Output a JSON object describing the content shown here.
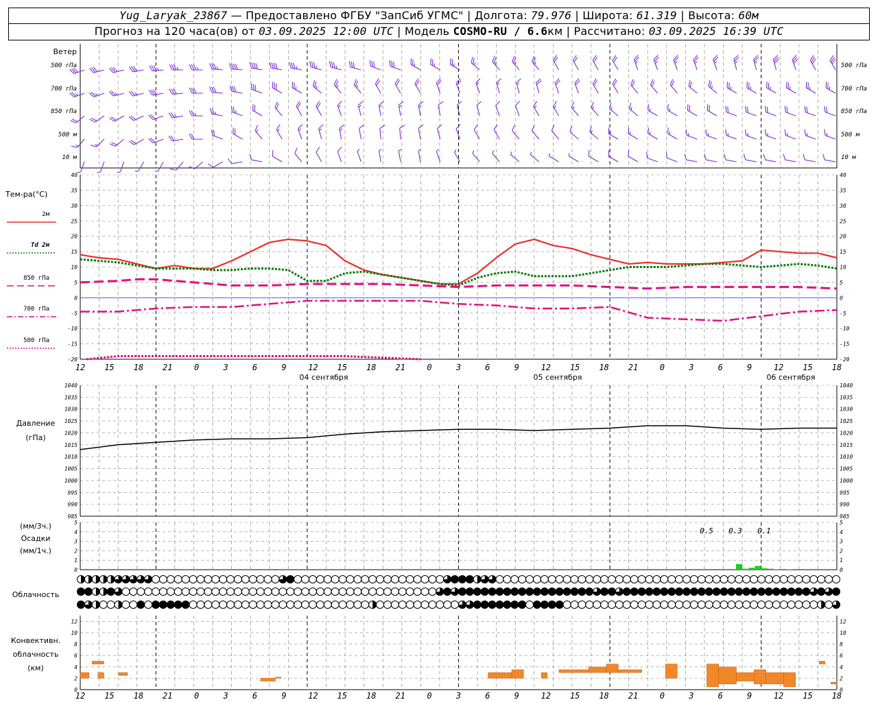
{
  "header": {
    "station": "Yug_Laryak_23867",
    "provider": "— Предоставлено ФГБУ \"ЗапСиб УГМС\"",
    "lon_label": "| Долгота:",
    "lon": "79.976",
    "lat_label": "| Широта:",
    "lat": "61.319",
    "alt_label": "| Высота:",
    "alt": "60м",
    "forecast_label": "Прогноз на 120 часа(ов) от",
    "start": "03.09.2025 12:00 UTC",
    "model_label": "| Модель",
    "model": "COSMO-RU / 6.6",
    "model_unit": "км",
    "calc_label": "| Рассчитано:",
    "calc": "03.09.2025 16:39 UTC"
  },
  "colors": {
    "wind": "#7b2bd6",
    "temp2m": "#e8302a",
    "td2m": "#0a7a0a",
    "t850": "#e0107c",
    "t700": "#e0107c",
    "t500": "#e0107c",
    "pressure": "#000000",
    "precip": "#22cc22",
    "conv": "#f0882a",
    "grid": "#8a8a8a",
    "zero": "#4040ff"
  },
  "labels": {
    "wind": "Ветер",
    "wind_levels": [
      "500 гПа",
      "700 гПа",
      "850 гПа",
      "500 м",
      "10 м"
    ],
    "temp_title": "Тем-ра(°C)",
    "temp_legend": [
      "2м",
      "Td 2м",
      "850 гПа",
      "700 гПа",
      "500 гПа"
    ],
    "pressure": [
      "Давление",
      "(гПа)"
    ],
    "precip": [
      "(мм/3ч.)",
      "Осадки",
      "(мм/1ч.)"
    ],
    "cloud": "Облачность",
    "conv": [
      "Конвективн.",
      "облачность",
      "(км)"
    ]
  },
  "axis": {
    "hour_ticks": [
      "12",
      "15",
      "18",
      "21",
      "0",
      "3",
      "6",
      "9",
      "12",
      "15",
      "18",
      "21",
      "0",
      "3",
      "6",
      "9",
      "12",
      "15",
      "18",
      "21",
      "0",
      "3",
      "6",
      "9",
      "12",
      "15",
      "18"
    ],
    "dates": [
      "04 сентября",
      "05 сентября",
      "06 сентября"
    ],
    "temp_ticks": [
      "40",
      "35",
      "30",
      "25",
      "20",
      "15",
      "10",
      "5",
      "0",
      "-5",
      "-10",
      "-15",
      "-20"
    ],
    "pressure_ticks": [
      "1040",
      "1035",
      "1030",
      "1025",
      "1020",
      "1015",
      "1010",
      "1005",
      "1000",
      "995",
      "990",
      "985"
    ],
    "precip_ticks": [
      "5",
      "4",
      "3",
      "2",
      "1",
      "0"
    ],
    "conv_ticks": [
      "12",
      "10",
      "8",
      "6",
      "4",
      "2",
      "0"
    ],
    "precip_totals": [
      "0.5",
      "0.3",
      "0.1"
    ]
  },
  "chart_data": [
    {
      "type": "line",
      "title": "Тем-ра(°C)",
      "x_unit": "hours since 03.09.2025 12:00 UTC",
      "ylim": [
        -20,
        40
      ],
      "series": [
        {
          "name": "2м",
          "x": [
            0,
            3,
            6,
            9,
            12,
            15,
            18,
            21,
            24,
            27,
            30,
            33,
            36,
            39,
            42,
            45,
            48,
            51,
            54,
            57,
            60,
            63,
            66,
            69,
            72,
            75,
            78,
            81,
            84,
            87,
            90,
            93,
            96,
            99,
            102,
            105,
            108,
            111,
            114,
            117,
            120
          ],
          "values": [
            14,
            13,
            12.5,
            11,
            9.5,
            10.5,
            9.5,
            9.5,
            12,
            15,
            18,
            19,
            18.5,
            17,
            12,
            9,
            7.5,
            6.5,
            5.5,
            4.5,
            4.5,
            8,
            13,
            17.5,
            19,
            17,
            16,
            14,
            12.5,
            11,
            11.5,
            11,
            11,
            11,
            11.5,
            12,
            15.5,
            15,
            14.5,
            14.5,
            13
          ]
        },
        {
          "name": "Td 2м",
          "x": [
            0,
            3,
            6,
            9,
            12,
            15,
            18,
            21,
            24,
            27,
            30,
            33,
            36,
            39,
            42,
            45,
            48,
            51,
            54,
            57,
            60,
            63,
            66,
            69,
            72,
            75,
            78,
            81,
            84,
            87,
            90,
            93,
            96,
            99,
            102,
            105,
            108,
            111,
            114,
            117,
            120
          ],
          "values": [
            12.5,
            12,
            11.5,
            10.5,
            9.5,
            9.5,
            9.5,
            9,
            9,
            9.5,
            9.5,
            9,
            5.5,
            5.5,
            8,
            8.5,
            7.5,
            6.5,
            5.5,
            4.5,
            4,
            6.5,
            8,
            8.5,
            7,
            7,
            7,
            8,
            9,
            10,
            10,
            10,
            10.5,
            11,
            11,
            10.5,
            10,
            10.5,
            11,
            10.5,
            9.5
          ]
        },
        {
          "name": "850 гПа",
          "x": [
            0,
            6,
            9,
            12,
            18,
            24,
            30,
            36,
            42,
            48,
            54,
            60,
            66,
            72,
            78,
            84,
            90,
            96,
            102,
            108,
            114,
            120
          ],
          "values": [
            5,
            5.5,
            6,
            6,
            5,
            4,
            4,
            4.5,
            4.5,
            4.5,
            4,
            3.5,
            4,
            4,
            4,
            3.5,
            3,
            3.5,
            3.5,
            3.5,
            3.5,
            3
          ]
        },
        {
          "name": "700 гПа",
          "x": [
            0,
            6,
            12,
            18,
            24,
            30,
            36,
            42,
            48,
            54,
            60,
            66,
            72,
            78,
            84,
            90,
            96,
            102,
            108,
            114,
            120
          ],
          "values": [
            -4.5,
            -4.5,
            -3.5,
            -3,
            -3,
            -2,
            -1,
            -1,
            -1,
            -1,
            -2,
            -2.5,
            -3.5,
            -3.5,
            -3,
            -6.5,
            -7,
            -7.5,
            -6,
            -4.5,
            -4
          ]
        },
        {
          "name": "500 гПа",
          "x": [
            1,
            6,
            12,
            18,
            24,
            30,
            36,
            42,
            48,
            54
          ],
          "values": [
            -20,
            -19,
            -19,
            -19,
            -19,
            -19,
            -19,
            -19,
            -19.5,
            -20
          ]
        }
      ]
    },
    {
      "type": "line",
      "title": "Давление (гПа)",
      "ylim": [
        985,
        1040
      ],
      "series": [
        {
          "name": "Давление",
          "x": [
            0,
            6,
            12,
            18,
            24,
            30,
            36,
            42,
            48,
            54,
            60,
            66,
            72,
            78,
            84,
            90,
            96,
            102,
            108,
            114,
            120
          ],
          "values": [
            1013,
            1015,
            1016,
            1017,
            1017.5,
            1017.5,
            1018,
            1019.5,
            1020.5,
            1021,
            1021.5,
            1021.5,
            1021,
            1021.5,
            1022,
            1023,
            1023,
            1022,
            1021.5,
            1022,
            1022
          ]
        }
      ]
    },
    {
      "type": "bar",
      "title": "Осадки (мм/1ч.)",
      "ylim": [
        0,
        5
      ],
      "x": [
        104,
        105,
        106,
        107,
        108,
        109,
        110,
        112
      ],
      "values": [
        0.6,
        0.1,
        0.2,
        0.4,
        0.15,
        0.1,
        0.05,
        0.05
      ]
    },
    {
      "type": "bar",
      "title": "Конвективн. облачность (км)",
      "ylim": [
        0,
        13
      ],
      "bars": [
        {
          "x": [
            0,
            1.5
          ],
          "base": 2,
          "top": 3
        },
        {
          "x": [
            2,
            4
          ],
          "base": 4.5,
          "top": 5
        },
        {
          "x": [
            3,
            4
          ],
          "base": 2,
          "top": 3
        },
        {
          "x": [
            6.5,
            8
          ],
          "base": 2.5,
          "top": 3
        },
        {
          "x": [
            30.5,
            33
          ],
          "base": 1.5,
          "top": 2
        },
        {
          "x": [
            33,
            34
          ],
          "base": 2,
          "top": 2.2
        },
        {
          "x": [
            69,
            73
          ],
          "base": 2,
          "top": 3
        },
        {
          "x": [
            73,
            75
          ],
          "base": 2,
          "top": 3.5
        },
        {
          "x": [
            78,
            79
          ],
          "base": 2,
          "top": 3
        },
        {
          "x": [
            81,
            86
          ],
          "base": 3,
          "top": 3.5
        },
        {
          "x": [
            86,
            89
          ],
          "base": 3,
          "top": 4
        },
        {
          "x": [
            89,
            91
          ],
          "base": 3,
          "top": 4.5
        },
        {
          "x": [
            91,
            95
          ],
          "base": 3,
          "top": 3.5
        },
        {
          "x": [
            99,
            101
          ],
          "base": 2,
          "top": 4.5
        },
        {
          "x": [
            106,
            108
          ],
          "base": 0.5,
          "top": 4.5
        },
        {
          "x": [
            108,
            111
          ],
          "base": 1,
          "top": 4
        },
        {
          "x": [
            111,
            114
          ],
          "base": 1.5,
          "top": 3
        },
        {
          "x": [
            114,
            116
          ],
          "base": 1,
          "top": 3.5
        },
        {
          "x": [
            116,
            119
          ],
          "base": 1,
          "top": 3
        },
        {
          "x": [
            119,
            121
          ],
          "base": 0.5,
          "top": 3
        },
        {
          "x": [
            125,
            126
          ],
          "base": 4.5,
          "top": 5
        },
        {
          "x": [
            127,
            128
          ],
          "base": 1,
          "top": 1.3
        }
      ]
    }
  ],
  "clouds": {
    "rows": [
      "mmmmmpppppeeeeeeeeeeeeeeeeepfeeeeeeeeeeeeeeeeeeeepfffmppeeeeeeeeeeeeeeeeeeeeeeeeeeeeeeeeeeeeeeeeeeeeee",
      "ffmmfpeeeeeeeeeeeeeeeeeeeeeeeeeeeeeeeeeeeeeeeeeepfpffffffffffffffffffpffpfffffffffffffffffffffffffpfpf",
      "fpmeemeefefffffeeeeeeeeeeeeeeeeeeeeeeeemeeeeeeeeeeeppfffffffeffffeeeeeeeeeeeeeeeeeeeeeeeeeeeeeeeeeemep"
    ]
  },
  "wind": {
    "levels": [
      "500 гПа",
      "700 гПа",
      "850 гПа",
      "500 м",
      "10 м"
    ],
    "direction_deg": [
      [
        250,
        255,
        255,
        260,
        265,
        270,
        270,
        275,
        275,
        280,
        280,
        280,
        285,
        285,
        285,
        290,
        290,
        300,
        300,
        300,
        310,
        320,
        320,
        320,
        330,
        330,
        330,
        330,
        340,
        340,
        340,
        340,
        340,
        345,
        345,
        345,
        340,
        330,
        330
      ],
      [
        250,
        250,
        255,
        255,
        260,
        265,
        270,
        275,
        280,
        290,
        300,
        300,
        310,
        320,
        320,
        330,
        330,
        330,
        340,
        340,
        340,
        345,
        345,
        345,
        340,
        340,
        330,
        330,
        320,
        320,
        320,
        310,
        310,
        300,
        300,
        300,
        300,
        300,
        300
      ],
      [
        230,
        235,
        240,
        245,
        250,
        260,
        270,
        280,
        290,
        300,
        320,
        330,
        330,
        340,
        345,
        350,
        350,
        350,
        350,
        345,
        345,
        340,
        340,
        330,
        330,
        320,
        320,
        310,
        310,
        300,
        300,
        300,
        300,
        290,
        290,
        290,
        290,
        290,
        290
      ],
      [
        220,
        225,
        230,
        240,
        250,
        260,
        270,
        290,
        300,
        320,
        330,
        340,
        345,
        350,
        350,
        355,
        355,
        350,
        345,
        340,
        330,
        330,
        320,
        320,
        320,
        310,
        310,
        300,
        300,
        300,
        300,
        290,
        290,
        290,
        290,
        290,
        290,
        290,
        290
      ],
      [
        200,
        200,
        200,
        210,
        210,
        220,
        230,
        240,
        260,
        280,
        300,
        320,
        330,
        340,
        340,
        350,
        350,
        350,
        340,
        330,
        320,
        320,
        310,
        310,
        300,
        300,
        300,
        300,
        300,
        290,
        290,
        280,
        280,
        280,
        280,
        280,
        280,
        280,
        280
      ]
    ],
    "speed_ms": [
      [
        12,
        12,
        13,
        13,
        14,
        14,
        15,
        15,
        16,
        16,
        16,
        15,
        15,
        14,
        13,
        12,
        12,
        11,
        11,
        11,
        10,
        10,
        10,
        10,
        9,
        9,
        9,
        9,
        10,
        10,
        10,
        10,
        11,
        11,
        11,
        12,
        12,
        12,
        12
      ],
      [
        10,
        10,
        11,
        11,
        12,
        12,
        12,
        13,
        13,
        12,
        12,
        11,
        11,
        10,
        10,
        9,
        9,
        8,
        8,
        8,
        7,
        7,
        7,
        8,
        8,
        8,
        8,
        8,
        9,
        9,
        9,
        9,
        10,
        10,
        10,
        10,
        10,
        10,
        10
      ],
      [
        8,
        8,
        9,
        9,
        9,
        10,
        10,
        10,
        10,
        9,
        9,
        8,
        8,
        7,
        7,
        6,
        6,
        6,
        5,
        5,
        5,
        5,
        5,
        6,
        6,
        6,
        7,
        7,
        7,
        7,
        7,
        8,
        8,
        8,
        8,
        8,
        8,
        8,
        8
      ],
      [
        7,
        7,
        8,
        8,
        8,
        8,
        8,
        8,
        8,
        7,
        7,
        7,
        6,
        6,
        5,
        5,
        5,
        5,
        5,
        4,
        4,
        4,
        5,
        5,
        5,
        5,
        6,
        6,
        6,
        6,
        6,
        6,
        6,
        6,
        6,
        6,
        6,
        6,
        6
      ],
      [
        3,
        3,
        3,
        3,
        3,
        4,
        4,
        4,
        4,
        4,
        4,
        4,
        4,
        4,
        3,
        3,
        3,
        3,
        3,
        3,
        3,
        3,
        3,
        3,
        3,
        3,
        4,
        4,
        4,
        4,
        4,
        4,
        4,
        4,
        4,
        4,
        4,
        4,
        4
      ]
    ]
  }
}
